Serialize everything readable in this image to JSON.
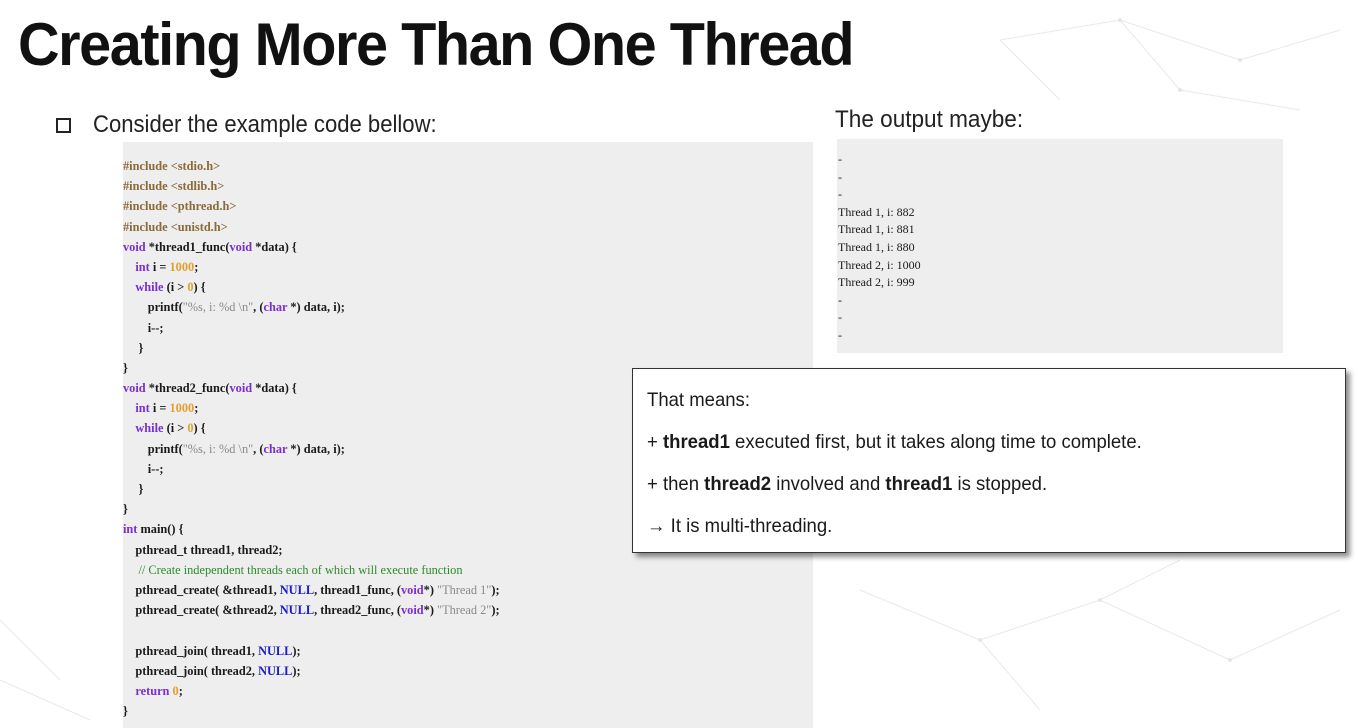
{
  "slide": {
    "title": "Creating More Than One Thread"
  },
  "bullet": {
    "icon": "checkbox-icon",
    "text": "Consider the example code bellow:"
  },
  "code": {
    "lines": [
      [
        {
          "t": "#include <stdio.h>",
          "c": "pp"
        }
      ],
      [
        {
          "t": "#include <stdlib.h>",
          "c": "pp"
        }
      ],
      [
        {
          "t": "#include <pthread.h>",
          "c": "pp"
        }
      ],
      [
        {
          "t": "#include <unistd.h>",
          "c": "pp"
        }
      ],
      [
        {
          "t": "void",
          "c": "kw"
        },
        {
          "t": " *thread1_func("
        },
        {
          "t": "void",
          "c": "kw"
        },
        {
          "t": " *data) {"
        }
      ],
      [
        {
          "t": "    "
        },
        {
          "t": "int",
          "c": "kw"
        },
        {
          "t": " i = "
        },
        {
          "t": "1000",
          "c": "num"
        },
        {
          "t": ";"
        }
      ],
      [
        {
          "t": "    "
        },
        {
          "t": "while",
          "c": "kw"
        },
        {
          "t": " (i > "
        },
        {
          "t": "0",
          "c": "num"
        },
        {
          "t": ") {"
        }
      ],
      [
        {
          "t": "        printf("
        },
        {
          "t": "\"%s, i: %d \\n\"",
          "c": "str"
        },
        {
          "t": ", ("
        },
        {
          "t": "char",
          "c": "kw"
        },
        {
          "t": " *) data, i);"
        }
      ],
      [
        {
          "t": "        i--;"
        }
      ],
      [
        {
          "t": "     }"
        }
      ],
      [
        {
          "t": "}"
        }
      ],
      [
        {
          "t": "void",
          "c": "kw"
        },
        {
          "t": " *thread2_func("
        },
        {
          "t": "void",
          "c": "kw"
        },
        {
          "t": " *data) {"
        }
      ],
      [
        {
          "t": "    "
        },
        {
          "t": "int",
          "c": "kw"
        },
        {
          "t": " i = "
        },
        {
          "t": "1000",
          "c": "num"
        },
        {
          "t": ";"
        }
      ],
      [
        {
          "t": "    "
        },
        {
          "t": "while",
          "c": "kw"
        },
        {
          "t": " (i > "
        },
        {
          "t": "0",
          "c": "num"
        },
        {
          "t": ") {"
        }
      ],
      [
        {
          "t": "        printf("
        },
        {
          "t": "\"%s, i: %d \\n\"",
          "c": "str"
        },
        {
          "t": ", ("
        },
        {
          "t": "char",
          "c": "kw"
        },
        {
          "t": " *) data, i);"
        }
      ],
      [
        {
          "t": "        i--;"
        }
      ],
      [
        {
          "t": "     }"
        }
      ],
      [
        {
          "t": "}"
        }
      ],
      [
        {
          "t": "int",
          "c": "kw"
        },
        {
          "t": " main() {"
        }
      ],
      [
        {
          "t": "    pthread_t thread1, thread2;"
        }
      ],
      [
        {
          "t": "     "
        },
        {
          "t": "// Create independent threads each of which will execute function",
          "c": "cmt"
        }
      ],
      [
        {
          "t": "    pthread_create( &thread1, "
        },
        {
          "t": "NULL",
          "c": "null"
        },
        {
          "t": ", thread1_func, ("
        },
        {
          "t": "void",
          "c": "kw"
        },
        {
          "t": "*) "
        },
        {
          "t": "\"Thread 1\"",
          "c": "str"
        },
        {
          "t": ");"
        }
      ],
      [
        {
          "t": "    pthread_create( &thread2, "
        },
        {
          "t": "NULL",
          "c": "null"
        },
        {
          "t": ", thread2_func, ("
        },
        {
          "t": "void",
          "c": "kw"
        },
        {
          "t": "*) "
        },
        {
          "t": "\"Thread 2\"",
          "c": "str"
        },
        {
          "t": ");"
        }
      ],
      [
        {
          "t": ""
        }
      ],
      [
        {
          "t": "    pthread_join( thread1, "
        },
        {
          "t": "NULL",
          "c": "null"
        },
        {
          "t": ");"
        }
      ],
      [
        {
          "t": "    pthread_join( thread2, "
        },
        {
          "t": "NULL",
          "c": "null"
        },
        {
          "t": ");"
        }
      ],
      [
        {
          "t": "    "
        },
        {
          "t": "return",
          "c": "kw"
        },
        {
          "t": " "
        },
        {
          "t": "0",
          "c": "num"
        },
        {
          "t": ";"
        }
      ],
      [
        {
          "t": "}"
        }
      ]
    ]
  },
  "output": {
    "title": "The output maybe:",
    "lines": [
      "-",
      "-",
      "-",
      "Thread 1, i: 882",
      "Thread 1, i: 881",
      "Thread 1, i: 880",
      "Thread 2, i: 1000",
      "Thread 2, i: 999",
      "-",
      "-",
      "-"
    ]
  },
  "means": {
    "heading": "That means:",
    "line1": {
      "prefix": "+ ",
      "bold": "thread1",
      "rest": " executed first, but it takes along time to complete."
    },
    "line2": {
      "prefix": "+ then ",
      "bold1": "thread2",
      "mid": " involved  and ",
      "bold2": "thread1",
      "rest": " is stopped."
    },
    "line3": "→ It is multi-threading."
  },
  "colors": {
    "code_background": "#eeeeee",
    "preprocessor": "#8a6a3a",
    "keyword": "#7a2fd0",
    "number": "#e0a030",
    "string": "#8a8a8a",
    "comment": "#2a8a2a",
    "null": "#1a1ad0"
  }
}
